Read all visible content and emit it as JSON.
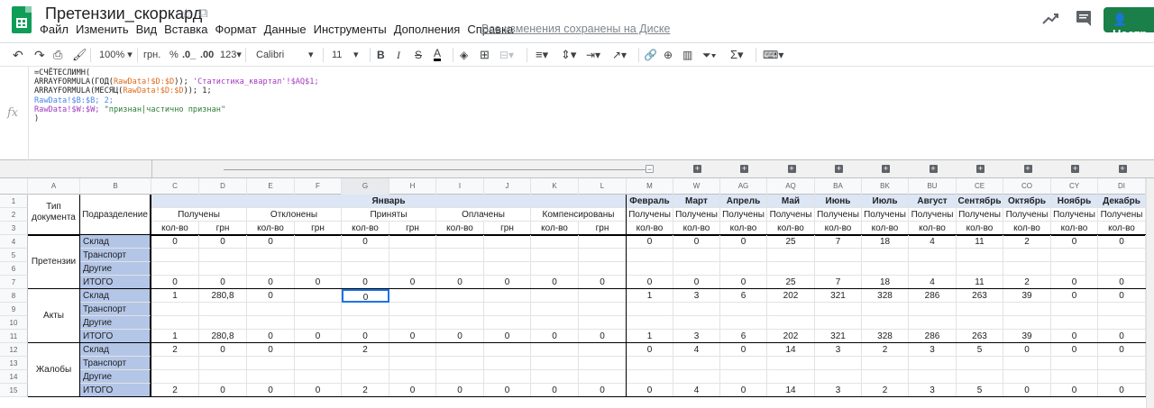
{
  "doc": {
    "title": "Претензии_скоркард",
    "save_status": "Все изменения сохранены на Диске",
    "share_label": "Настр"
  },
  "menu": [
    "Файл",
    "Изменить",
    "Вид",
    "Вставка",
    "Формат",
    "Данные",
    "Инструменты",
    "Дополнения",
    "Справка"
  ],
  "toolbar": {
    "zoom": "100%",
    "currency": "грн.",
    "percent": "%",
    "dec_less": ".0_",
    "dec_more": ".00",
    "num_format": "123",
    "font": "Calibri",
    "size": "11"
  },
  "formula_lines": [
    "=СЧЁТЕСЛИМН(",
    "ARRAYFORMULA(ГОД(RawData!$D:$D)); 'Статистика_квартал'!$AQ$1;",
    "ARRAYFORMULA(МЕСЯЦ(RawData!$D:$D)); 1;",
    "RawData!$B:$B; 2;",
    "RawData!$W:$W; \"признан|частично признан\"",
    ")"
  ],
  "colors": {
    "accent": "#0f9d58",
    "header_fill": "#dce6f5",
    "sub_fill": "#b4c6e7"
  },
  "col_letters": [
    "A",
    "B",
    "C",
    "D",
    "E",
    "F",
    "G",
    "H",
    "I",
    "J",
    "K",
    "L",
    "M",
    "W",
    "AG",
    "AQ",
    "BA",
    "BK",
    "BU",
    "CE",
    "CO",
    "CY",
    "DI"
  ],
  "row_numbers": [
    "1",
    "2",
    "3",
    "4",
    "5",
    "6",
    "7",
    "8",
    "9",
    "10",
    "11",
    "12",
    "13",
    "14",
    "15"
  ],
  "headers": {
    "doc_type": "Тип документа",
    "division": "Подразделение",
    "january": "Январь",
    "groups": [
      "Получены",
      "Отклонены",
      "Приняты",
      "Оплачены",
      "Компенсированы"
    ],
    "qty": "кол-во",
    "uah": "грн",
    "months": [
      "Февраль",
      "Март",
      "Апрель",
      "Май",
      "Июнь",
      "Июль",
      "Август",
      "Сентябрь",
      "Октябрь",
      "Ноябрь",
      "Декабрь"
    ],
    "received": "Получены"
  },
  "sections": [
    {
      "name": "Претензии",
      "rows": [
        {
          "label": "Склад",
          "vals": [
            "0",
            "0",
            "0",
            "",
            "0",
            "",
            "",
            "",
            "",
            "",
            "0",
            "0",
            "0",
            "25",
            "7",
            "18",
            "4",
            "11",
            "2",
            "0",
            "0"
          ]
        },
        {
          "label": "Транспорт",
          "vals": [
            "",
            "",
            "",
            "",
            "",
            "",
            "",
            "",
            "",
            "",
            "",
            "",
            "",
            "",
            "",
            "",
            "",
            "",
            "",
            "",
            ""
          ]
        },
        {
          "label": "Другие",
          "vals": [
            "",
            "",
            "",
            "",
            "",
            "",
            "",
            "",
            "",
            "",
            "",
            "",
            "",
            "",
            "",
            "",
            "",
            "",
            "",
            "",
            ""
          ]
        },
        {
          "label": "ИТОГО",
          "vals": [
            "0",
            "0",
            "0",
            "0",
            "0",
            "0",
            "0",
            "0",
            "0",
            "0",
            "0",
            "0",
            "0",
            "25",
            "7",
            "18",
            "4",
            "11",
            "2",
            "0",
            "0"
          ]
        }
      ]
    },
    {
      "name": "Акты",
      "rows": [
        {
          "label": "Склад",
          "vals": [
            "1",
            "280,8",
            "0",
            "",
            "0",
            "",
            "",
            "",
            "",
            "",
            "1",
            "3",
            "6",
            "202",
            "321",
            "328",
            "286",
            "263",
            "39",
            "0",
            "0"
          ]
        },
        {
          "label": "Транспорт",
          "vals": [
            "",
            "",
            "",
            "",
            "",
            "",
            "",
            "",
            "",
            "",
            "",
            "",
            "",
            "",
            "",
            "",
            "",
            "",
            "",
            "",
            ""
          ]
        },
        {
          "label": "Другие",
          "vals": [
            "",
            "",
            "",
            "",
            "",
            "",
            "",
            "",
            "",
            "",
            "",
            "",
            "",
            "",
            "",
            "",
            "",
            "",
            "",
            "",
            ""
          ]
        },
        {
          "label": "ИТОГО",
          "vals": [
            "1",
            "280,8",
            "0",
            "0",
            "0",
            "0",
            "0",
            "0",
            "0",
            "0",
            "1",
            "3",
            "6",
            "202",
            "321",
            "328",
            "286",
            "263",
            "39",
            "0",
            "0"
          ]
        }
      ]
    },
    {
      "name": "Жалобы",
      "rows": [
        {
          "label": "Склад",
          "vals": [
            "2",
            "0",
            "0",
            "",
            "2",
            "",
            "",
            "",
            "",
            "",
            "0",
            "4",
            "0",
            "14",
            "3",
            "2",
            "3",
            "5",
            "0",
            "0",
            "0"
          ]
        },
        {
          "label": "Транспорт",
          "vals": [
            "",
            "",
            "",
            "",
            "",
            "",
            "",
            "",
            "",
            "",
            "",
            "",
            "",
            "",
            "",
            "",
            "",
            "",
            "",
            "",
            ""
          ]
        },
        {
          "label": "Другие",
          "vals": [
            "",
            "",
            "",
            "",
            "",
            "",
            "",
            "",
            "",
            "",
            "",
            "",
            "",
            "",
            "",
            "",
            "",
            "",
            "",
            "",
            ""
          ]
        },
        {
          "label": "ИТОГО",
          "vals": [
            "2",
            "0",
            "0",
            "0",
            "2",
            "0",
            "0",
            "0",
            "0",
            "0",
            "0",
            "4",
            "0",
            "14",
            "3",
            "2",
            "3",
            "5",
            "0",
            "0",
            "0"
          ]
        }
      ]
    }
  ]
}
